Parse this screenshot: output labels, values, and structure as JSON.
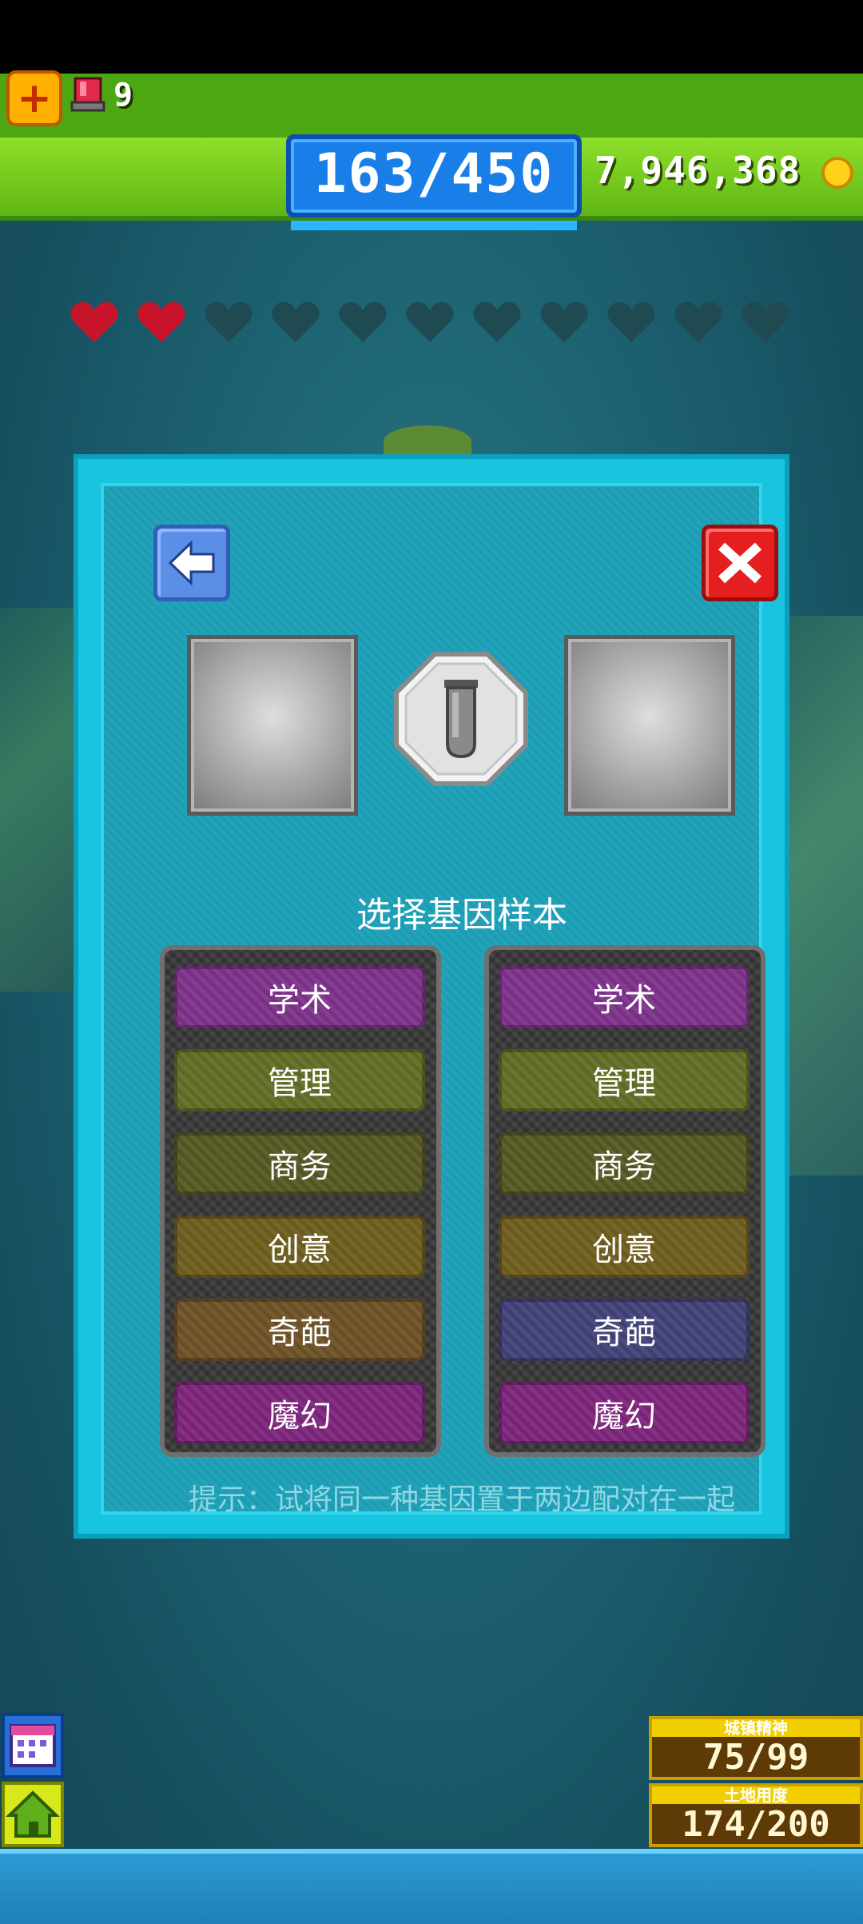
{
  "hud": {
    "alarm_count": "9",
    "population": "163/450",
    "coins": "7,946,368"
  },
  "hearts": {
    "filled": 2,
    "total": 11,
    "filled_color": "#c8142a",
    "empty_color": "#1f4a52"
  },
  "dialog": {
    "title": "选择基因样本",
    "left_genes": [
      {
        "label": "学术",
        "color": "#7a2f86"
      },
      {
        "label": "管理",
        "color": "#5e6a22"
      },
      {
        "label": "商务",
        "color": "#535520"
      },
      {
        "label": "创意",
        "color": "#6b5a1c"
      },
      {
        "label": "奇葩",
        "color": "#6b4f24"
      },
      {
        "label": "魔幻",
        "color": "#7a2278"
      }
    ],
    "right_genes": [
      {
        "label": "学术",
        "color": "#7a2f86"
      },
      {
        "label": "管理",
        "color": "#5e6a22"
      },
      {
        "label": "商务",
        "color": "#535520"
      },
      {
        "label": "创意",
        "color": "#6b5a1c"
      },
      {
        "label": "奇葩",
        "color": "#3e3f74"
      },
      {
        "label": "魔幻",
        "color": "#7a2278"
      }
    ],
    "hint": "提示：试将同一种基因置于两边配对在一起"
  },
  "stats": {
    "spirit_label": "城镇精神",
    "spirit_value": "75/99",
    "land_label": "土地用度",
    "land_value": "174/200"
  },
  "icons": [
    "plus-icon",
    "alarm-icon",
    "coin-icon",
    "heart-icon",
    "back-arrow-icon",
    "close-icon",
    "test-tube-icon",
    "calendar-icon",
    "home-icon"
  ]
}
